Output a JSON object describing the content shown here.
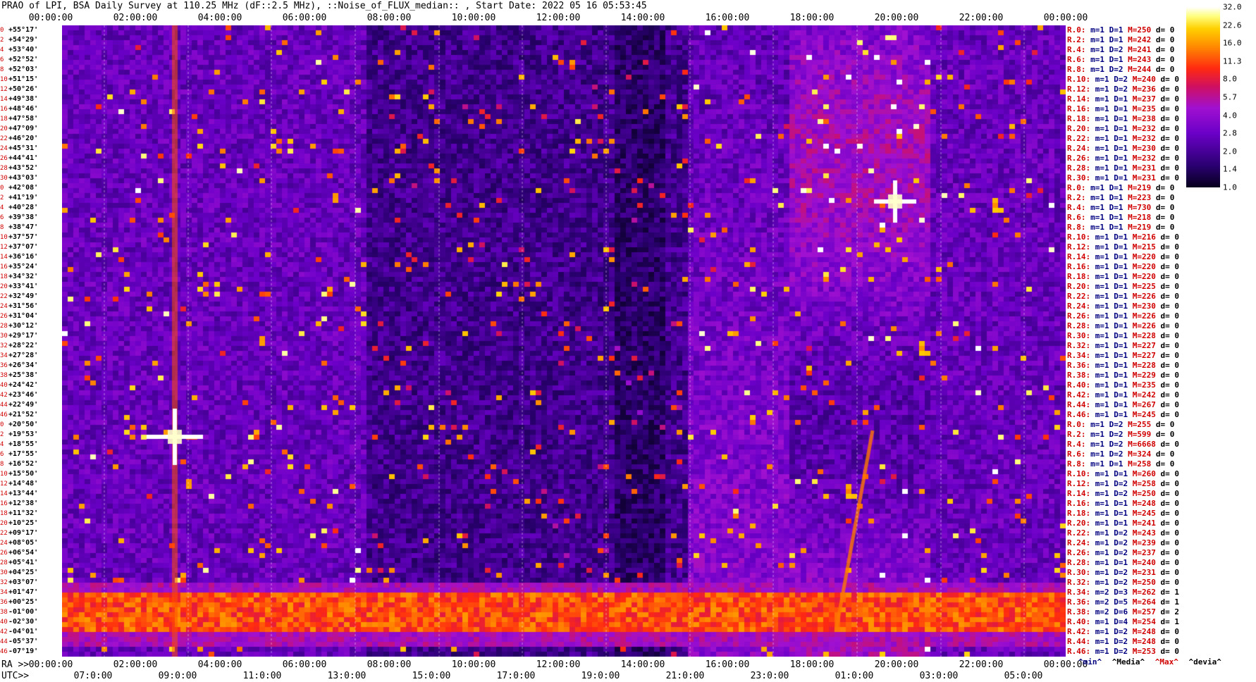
{
  "title": "PRAO of LPI, BSA Daily Survey at 110.25 MHz (dF::2.5 MHz), ::Noise_of_FLUX_median:: , Start Date: 2022 05 16 05:53:45",
  "top_axis": [
    "00:00:00",
    "02:00:00",
    "04:00:00",
    "06:00:00",
    "08:00:00",
    "10:00:00",
    "12:00:00",
    "14:00:00",
    "16:00:00",
    "18:00:00",
    "20:00:00",
    "22:00:00",
    "00:00:00"
  ],
  "bottom_axis_ra_prefix": "RA >>",
  "bottom_axis_ra": [
    "00:00:00",
    "02:00:00",
    "04:00:00",
    "06:00:00",
    "08:00:00",
    "10:00:00",
    "12:00:00",
    "14:00:00",
    "16:00:00",
    "18:00:00",
    "20:00:00",
    "22:00:00",
    "00:00:00"
  ],
  "bottom_axis_utc_prefix": "UTC>>",
  "bottom_axis_utc": [
    "07:0:00",
    "09:0:00",
    "11:0:00",
    "13:0:00",
    "15:0:00",
    "17:0:00",
    "19:0:00",
    "21:0:00",
    "23:0:00",
    "01:0:00",
    "03:0:00",
    "05:0:00"
  ],
  "declinations": [
    "+55°17'",
    "+54°29'",
    "+53°40'",
    "+52°52'",
    "+52°03'",
    "+51°15'",
    "+50°26'",
    "+49°38'",
    "+48°46'",
    "+47°58'",
    "+47°09'",
    "+46°20'",
    "+45°31'",
    "+44°41'",
    "+43°52'",
    "+43°03'",
    "+42°08'",
    "+41°19'",
    "+40°28'",
    "+39°38'",
    "+38°47'",
    "+37°57'",
    "+37°07'",
    "+36°16'",
    "+35°24'",
    "+34°32'",
    "+33°41'",
    "+32°49'",
    "+31°56'",
    "+31°04'",
    "+30°12'",
    "+29°17'",
    "+28°22'",
    "+27°28'",
    "+26°34'",
    "+25°38'",
    "+24°42'",
    "+23°46'",
    "+22°49'",
    "+21°52'",
    "+20°50'",
    "+19°53'",
    "+18°55'",
    "+17°55'",
    "+16°52'",
    "+15°50'",
    "+14°48'",
    "+13°44'",
    "+12°38'",
    "+11°32'",
    "+10°25'",
    "+09°17'",
    "+08°05'",
    "+06°54'",
    "+05°41'",
    "+04°25'",
    "+03°07'",
    "+01°47'",
    "+00°25'",
    "-01°00'",
    "-02°30'",
    "-04°01'",
    "-05°37'",
    "-07°19'"
  ],
  "dec_indices": [
    "0",
    "2",
    "4",
    "6",
    "8",
    "10",
    "12",
    "14",
    "16",
    "18",
    "20",
    "22",
    "24",
    "26",
    "28",
    "30",
    "0",
    "2",
    "4",
    "6",
    "8",
    "10",
    "12",
    "14",
    "16",
    "18",
    "20",
    "22",
    "24",
    "26",
    "28",
    "30",
    "32",
    "34",
    "36",
    "38",
    "40",
    "42",
    "44",
    "46",
    "0",
    "2",
    "4",
    "6",
    "8",
    "10",
    "12",
    "14",
    "16",
    "18",
    "20",
    "22",
    "24",
    "26",
    "28",
    "30",
    "32",
    "34",
    "36",
    "38",
    "40",
    "42",
    "44",
    "46"
  ],
  "right_rows": [
    {
      "r": "R.0:",
      "m": "1",
      "D": "1",
      "M": "250",
      "d": "0"
    },
    {
      "r": "R.2:",
      "m": "1",
      "D": "1",
      "M": "242",
      "d": "0"
    },
    {
      "r": "R.4:",
      "m": "1",
      "D": "2",
      "M": "241",
      "d": "0"
    },
    {
      "r": "R.6:",
      "m": "1",
      "D": "1",
      "M": "243",
      "d": "0"
    },
    {
      "r": "R.8:",
      "m": "1",
      "D": "2",
      "M": "244",
      "d": "0"
    },
    {
      "r": "R.10:",
      "m": "1",
      "D": "2",
      "M": "240",
      "d": "0"
    },
    {
      "r": "R.12:",
      "m": "1",
      "D": "2",
      "M": "236",
      "d": "0"
    },
    {
      "r": "R.14:",
      "m": "1",
      "D": "1",
      "M": "237",
      "d": "0"
    },
    {
      "r": "R.16:",
      "m": "1",
      "D": "1",
      "M": "235",
      "d": "0"
    },
    {
      "r": "R.18:",
      "m": "1",
      "D": "1",
      "M": "238",
      "d": "0"
    },
    {
      "r": "R.20:",
      "m": "1",
      "D": "1",
      "M": "232",
      "d": "0"
    },
    {
      "r": "R.22:",
      "m": "1",
      "D": "1",
      "M": "232",
      "d": "0"
    },
    {
      "r": "R.24:",
      "m": "1",
      "D": "1",
      "M": "230",
      "d": "0"
    },
    {
      "r": "R.26:",
      "m": "1",
      "D": "1",
      "M": "232",
      "d": "0"
    },
    {
      "r": "R.28:",
      "m": "1",
      "D": "1",
      "M": "231",
      "d": "0"
    },
    {
      "r": "R.30:",
      "m": "1",
      "D": "1",
      "M": "231",
      "d": "0"
    },
    {
      "r": "R.0:",
      "m": "1",
      "D": "1",
      "M": "219",
      "d": "0"
    },
    {
      "r": "R.2:",
      "m": "1",
      "D": "1",
      "M": "223",
      "d": "0"
    },
    {
      "r": "R.4:",
      "m": "1",
      "D": "1",
      "M": "730",
      "d": "0"
    },
    {
      "r": "R.6:",
      "m": "1",
      "D": "1",
      "M": "218",
      "d": "0"
    },
    {
      "r": "R.8:",
      "m": "1",
      "D": "1",
      "M": "219",
      "d": "0"
    },
    {
      "r": "R.10:",
      "m": "1",
      "D": "1",
      "M": "216",
      "d": "0"
    },
    {
      "r": "R.12:",
      "m": "1",
      "D": "1",
      "M": "215",
      "d": "0"
    },
    {
      "r": "R.14:",
      "m": "1",
      "D": "1",
      "M": "220",
      "d": "0"
    },
    {
      "r": "R.16:",
      "m": "1",
      "D": "1",
      "M": "220",
      "d": "0"
    },
    {
      "r": "R.18:",
      "m": "1",
      "D": "1",
      "M": "220",
      "d": "0"
    },
    {
      "r": "R.20:",
      "m": "1",
      "D": "1",
      "M": "225",
      "d": "0"
    },
    {
      "r": "R.22:",
      "m": "1",
      "D": "1",
      "M": "226",
      "d": "0"
    },
    {
      "r": "R.24:",
      "m": "1",
      "D": "1",
      "M": "230",
      "d": "0"
    },
    {
      "r": "R.26:",
      "m": "1",
      "D": "1",
      "M": "226",
      "d": "0"
    },
    {
      "r": "R.28:",
      "m": "1",
      "D": "1",
      "M": "226",
      "d": "0"
    },
    {
      "r": "R.30:",
      "m": "1",
      "D": "1",
      "M": "228",
      "d": "0"
    },
    {
      "r": "R.32:",
      "m": "1",
      "D": "1",
      "M": "227",
      "d": "0"
    },
    {
      "r": "R.34:",
      "m": "1",
      "D": "1",
      "M": "227",
      "d": "0"
    },
    {
      "r": "R.36:",
      "m": "1",
      "D": "1",
      "M": "228",
      "d": "0"
    },
    {
      "r": "R.38:",
      "m": "1",
      "D": "1",
      "M": "229",
      "d": "0"
    },
    {
      "r": "R.40:",
      "m": "1",
      "D": "1",
      "M": "235",
      "d": "0"
    },
    {
      "r": "R.42:",
      "m": "1",
      "D": "1",
      "M": "242",
      "d": "0"
    },
    {
      "r": "R.44:",
      "m": "1",
      "D": "1",
      "M": "267",
      "d": "0"
    },
    {
      "r": "R.46:",
      "m": "1",
      "D": "1",
      "M": "245",
      "d": "0"
    },
    {
      "r": "R.0:",
      "m": "1",
      "D": "2",
      "M": "255",
      "d": "0"
    },
    {
      "r": "R.2:",
      "m": "1",
      "D": "2",
      "M": "599",
      "d": "0"
    },
    {
      "r": "R.4:",
      "m": "1",
      "D": "2",
      "M": "6668",
      "d": "0"
    },
    {
      "r": "R.6:",
      "m": "1",
      "D": "2",
      "M": "324",
      "d": "0"
    },
    {
      "r": "R.8:",
      "m": "1",
      "D": "1",
      "M": "258",
      "d": "0"
    },
    {
      "r": "R.10:",
      "m": "1",
      "D": "1",
      "M": "260",
      "d": "0"
    },
    {
      "r": "R.12:",
      "m": "1",
      "D": "2",
      "M": "258",
      "d": "0"
    },
    {
      "r": "R.14:",
      "m": "1",
      "D": "2",
      "M": "250",
      "d": "0"
    },
    {
      "r": "R.16:",
      "m": "1",
      "D": "1",
      "M": "248",
      "d": "0"
    },
    {
      "r": "R.18:",
      "m": "1",
      "D": "1",
      "M": "245",
      "d": "0"
    },
    {
      "r": "R.20:",
      "m": "1",
      "D": "1",
      "M": "241",
      "d": "0"
    },
    {
      "r": "R.22:",
      "m": "1",
      "D": "2",
      "M": "243",
      "d": "0"
    },
    {
      "r": "R.24:",
      "m": "1",
      "D": "2",
      "M": "239",
      "d": "0"
    },
    {
      "r": "R.26:",
      "m": "1",
      "D": "2",
      "M": "237",
      "d": "0"
    },
    {
      "r": "R.28:",
      "m": "1",
      "D": "1",
      "M": "240",
      "d": "0"
    },
    {
      "r": "R.30:",
      "m": "1",
      "D": "2",
      "M": "231",
      "d": "0"
    },
    {
      "r": "R.32:",
      "m": "1",
      "D": "2",
      "M": "250",
      "d": "0"
    },
    {
      "r": "R.34:",
      "m": "2",
      "D": "3",
      "M": "262",
      "d": "1"
    },
    {
      "r": "R.36:",
      "m": "2",
      "D": "5",
      "M": "264",
      "d": "1"
    },
    {
      "r": "R.38:",
      "m": "2",
      "D": "6",
      "M": "257",
      "d": "2"
    },
    {
      "r": "R.40:",
      "m": "1",
      "D": "4",
      "M": "254",
      "d": "1"
    },
    {
      "r": "R.42:",
      "m": "1",
      "D": "2",
      "M": "248",
      "d": "0"
    },
    {
      "r": "R.44:",
      "m": "1",
      "D": "2",
      "M": "248",
      "d": "0"
    },
    {
      "r": "R.46:",
      "m": "1",
      "D": "2",
      "M": "253",
      "d": "0"
    }
  ],
  "legend": {
    "min": "^min^",
    "media": "^Media^",
    "max": "^Max^",
    "devia": "^devia^"
  },
  "colorbar_ticks": [
    "32.0",
    "22.6",
    "16.0",
    "11.3",
    "8.0",
    "5.7",
    "4.0",
    "2.8",
    "2.0",
    "1.4",
    "1.0"
  ],
  "colors": {
    "label_red": "#d00000",
    "label_blue": "#000080",
    "bg": "#ffffff"
  }
}
